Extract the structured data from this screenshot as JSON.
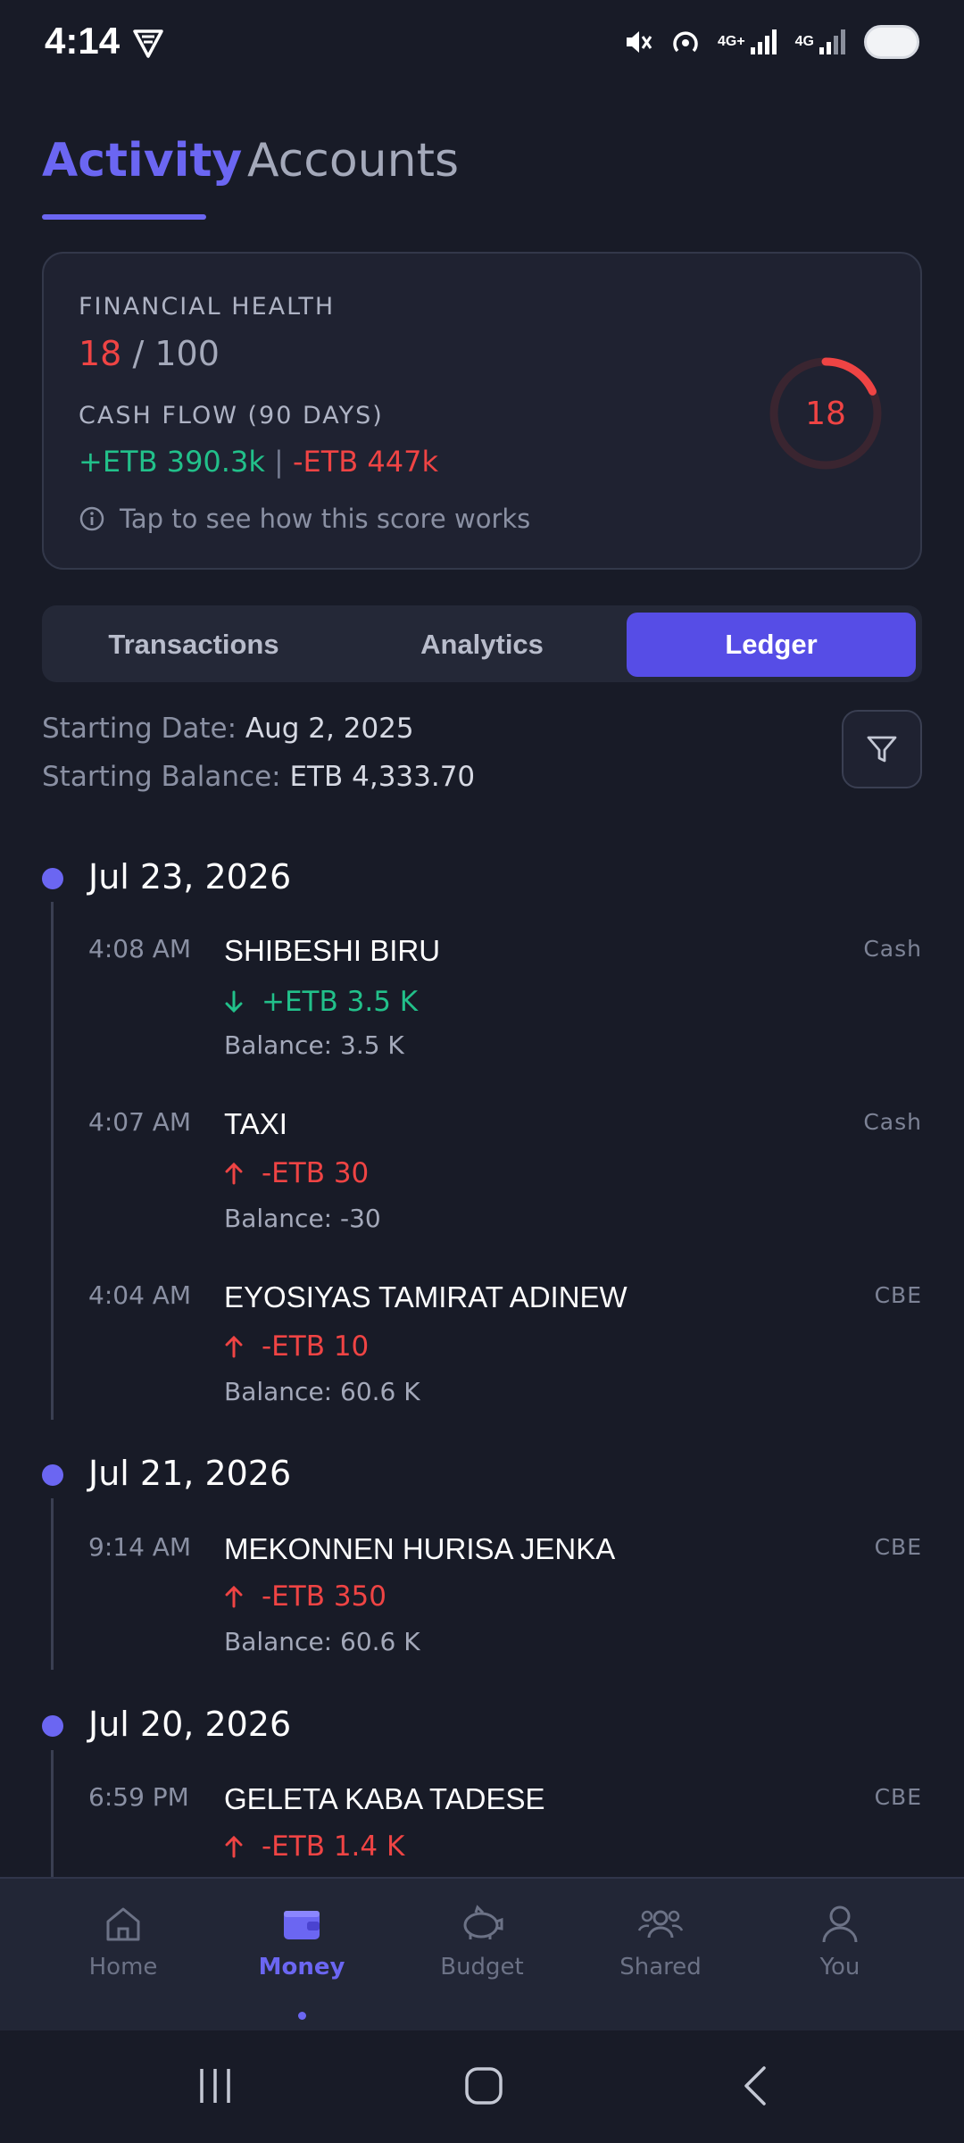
{
  "status_bar": {
    "time": "4:14",
    "network_1": "4G+",
    "network_2": "4G"
  },
  "tabs": {
    "activity": "Activity",
    "accounts": "Accounts"
  },
  "health": {
    "title": "FINANCIAL HEALTH",
    "score": "18",
    "separator": "/",
    "max": "100",
    "cashflow_title": "CASH FLOW (90 DAYS)",
    "inflow": "+ETB 390.3k",
    "divider": "|",
    "outflow": "-ETB 447k",
    "tip": "Tap to see how this score works",
    "gauge_value": "18",
    "gauge_fraction": 0.18
  },
  "segments": {
    "transactions": "Transactions",
    "analytics": "Analytics",
    "ledger": "Ledger"
  },
  "ledger_info": {
    "start_date_label": "Starting Date:",
    "start_date": "Aug 2, 2025",
    "start_balance_label": "Starting Balance:",
    "start_balance": "ETB 4,333.70"
  },
  "groups": [
    {
      "date": "Jul 23, 2026",
      "items": [
        {
          "time": "4:08 AM",
          "name": "SHIBESHI BIRU",
          "account": "Cash",
          "direction": "in",
          "amount": "+ETB 3.5 K",
          "balance": "Balance: 3.5 K"
        },
        {
          "time": "4:07 AM",
          "name": "TAXI",
          "account": "Cash",
          "direction": "out",
          "amount": "-ETB 30",
          "balance": "Balance: -30"
        },
        {
          "time": "4:04 AM",
          "name": "EYOSIYAS TAMIRAT ADINEW",
          "account": "CBE",
          "direction": "out",
          "amount": "-ETB 10",
          "balance": "Balance: 60.6 K"
        }
      ]
    },
    {
      "date": "Jul 21, 2026",
      "items": [
        {
          "time": "9:14 AM",
          "name": "MEKONNEN HURISA JENKA",
          "account": "CBE",
          "direction": "out",
          "amount": "-ETB 350",
          "balance": "Balance: 60.6 K"
        }
      ]
    },
    {
      "date": "Jul 20, 2026",
      "items": [
        {
          "time": "6:59 PM",
          "name": "GELETA KABA TADESE",
          "account": "CBE",
          "direction": "out",
          "amount": "-ETB 1.4 K",
          "balance": ""
        }
      ]
    }
  ],
  "bottom_nav": {
    "home": "Home",
    "money": "Money",
    "budget": "Budget",
    "shared": "Shared",
    "you": "You"
  },
  "colors": {
    "accent": "#6b66f2",
    "positive": "#22c08a",
    "negative": "#ef4444",
    "background": "#181b27"
  }
}
